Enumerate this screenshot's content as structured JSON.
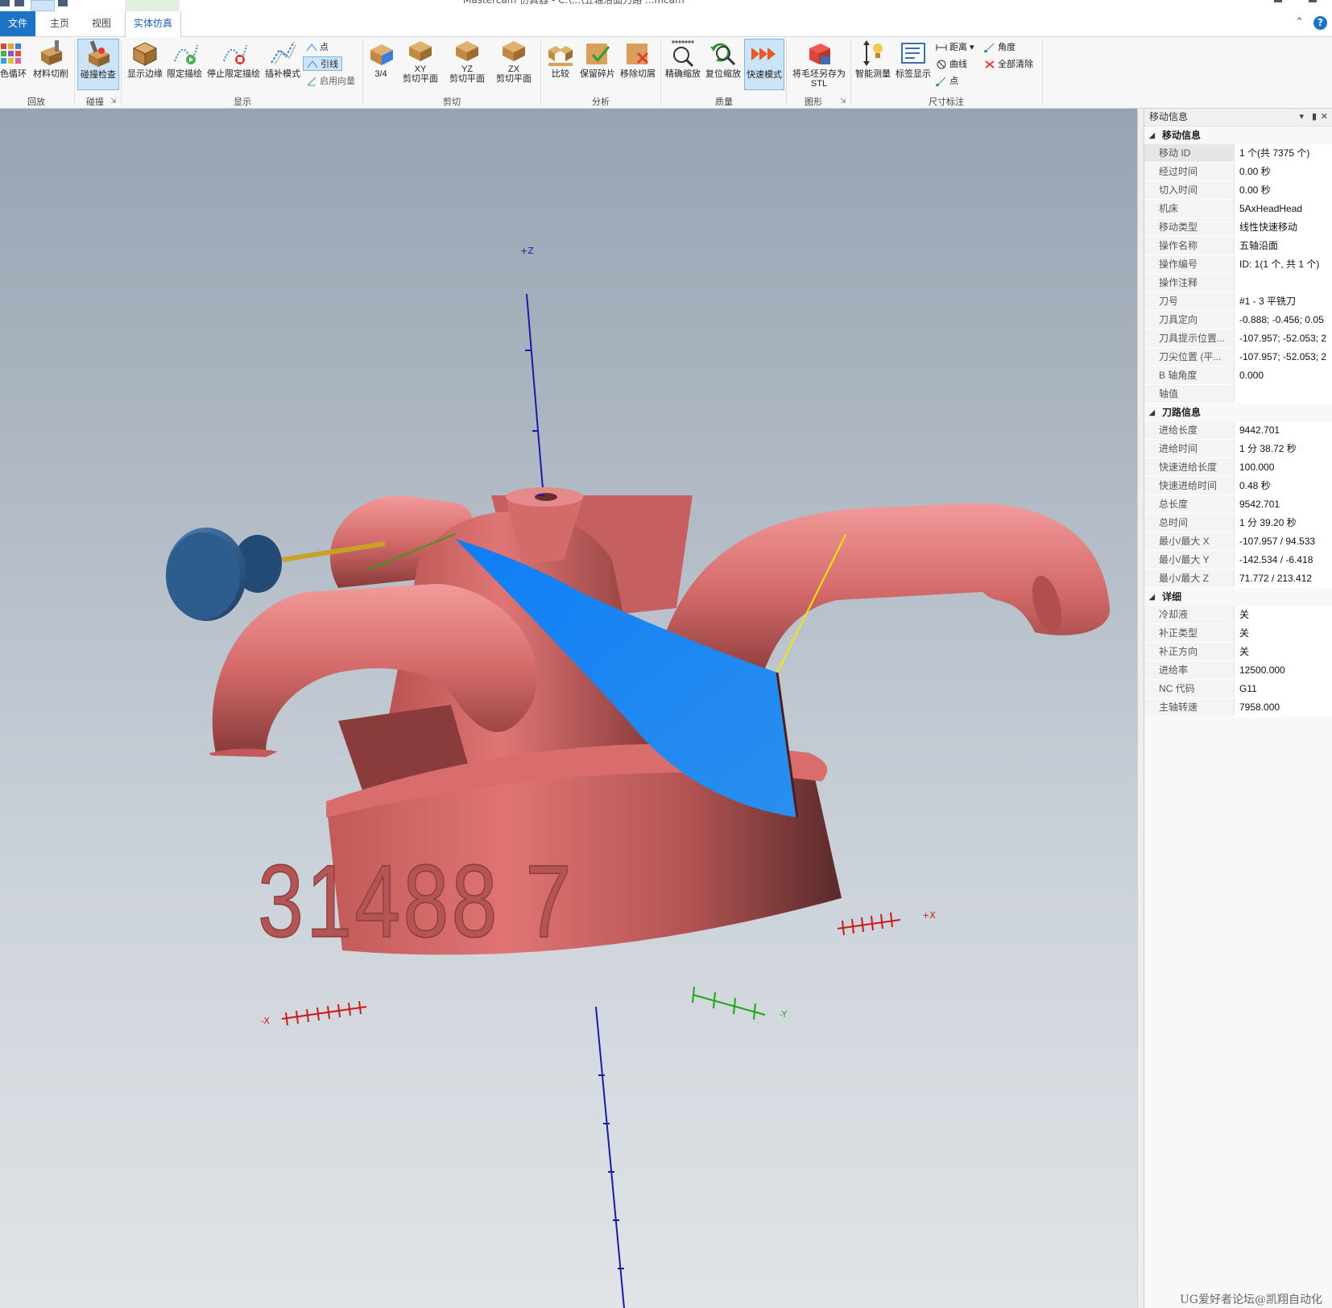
{
  "window": {
    "title": "Mastercam 仿真器 - C:\\...\\五轴沿面刀路 ...mcam"
  },
  "tabs": {
    "file": "文件",
    "home": "主页",
    "view": "视图",
    "sim": "实体仿真"
  },
  "ribbon": {
    "replay": {
      "color_cycle": "颜色循环",
      "material_cut": "材料切削",
      "group": "回放"
    },
    "collision": {
      "check": "碰撞检查",
      "group": "碰撞"
    },
    "display": {
      "show_edges": "显示边缘",
      "limit_draw": "限定描绘",
      "stop_limit": "停止限定描绘",
      "interp_mode": "插补模式",
      "point": "点",
      "lead": "引线",
      "enable_vector": "启用向量",
      "group": "显示"
    },
    "clip": {
      "three_quarter": "3/4",
      "xy1": "XY",
      "xy2": "剪切平面",
      "yz1": "YZ",
      "yz2": "剪切平面",
      "zx1": "ZX",
      "zx2": "剪切平面",
      "group": "剪切"
    },
    "analysis": {
      "compare": "比较",
      "keep_chips": "保留碎片",
      "remove_chips": "移除切屑",
      "group": "分析"
    },
    "quality": {
      "precise_zoom": "精确缩放",
      "reset_zoom": "复位缩放",
      "fast_mode": "快速模式",
      "group": "质量"
    },
    "graphics": {
      "save_stl_1": "将毛坯另存为",
      "save_stl_2": "STL",
      "group": "图形"
    },
    "dimension": {
      "smart_measure": "智能测量",
      "label_display": "标签显示",
      "distance": "距离",
      "curve": "曲线",
      "point": "点",
      "angle": "角度",
      "clear_all": "全部清除",
      "group": "尺寸标注"
    }
  },
  "viewport": {
    "axes": {
      "pz": "+Z",
      "px": "+X",
      "nx": "-X",
      "ny": "-Y"
    },
    "engraving": "31488 7",
    "colors": {
      "part": "#d66a6a",
      "toolpath": "#1f86f2",
      "holder": "#2d5c8f",
      "tool": "#c8a12b"
    }
  },
  "panel": {
    "title": "移动信息",
    "sections": [
      {
        "name": "移动信息",
        "rows": [
          {
            "k": "移动 ID",
            "v": "1 个(共 7375 个)"
          },
          {
            "k": "经过时间",
            "v": "0.00 秒"
          },
          {
            "k": "切入时间",
            "v": "0.00 秒"
          },
          {
            "k": "机床",
            "v": "5AxHeadHead"
          },
          {
            "k": "移动类型",
            "v": "线性快速移动"
          },
          {
            "k": "操作名称",
            "v": "五轴沿面"
          },
          {
            "k": "操作编号",
            "v": "ID: 1(1 个, 共 1 个)"
          },
          {
            "k": "操作注释",
            "v": ""
          },
          {
            "k": "刀号",
            "v": "#1 - 3 平铣刀"
          },
          {
            "k": "刀具定向",
            "v": "-0.888; -0.456; 0.05"
          },
          {
            "k": "刀具提示位置...",
            "v": "-107.957; -52.053; 2"
          },
          {
            "k": "刀尖位置 (平...",
            "v": "-107.957; -52.053; 2"
          },
          {
            "k": "B 轴角度",
            "v": "0.000"
          },
          {
            "k": "轴值",
            "v": ""
          }
        ]
      },
      {
        "name": "刀路信息",
        "rows": [
          {
            "k": "进给长度",
            "v": "9442.701"
          },
          {
            "k": "进给时间",
            "v": "1 分 38.72 秒"
          },
          {
            "k": "快速进给长度",
            "v": "100.000"
          },
          {
            "k": "快速进给时间",
            "v": "0.48 秒"
          },
          {
            "k": "总长度",
            "v": "9542.701"
          },
          {
            "k": "总时间",
            "v": "1 分 39.20 秒"
          },
          {
            "k": "最小/最大 X",
            "v": "-107.957 / 94.533"
          },
          {
            "k": "最小/最大 Y",
            "v": "-142.534 / -6.418"
          },
          {
            "k": "最小/最大 Z",
            "v": "71.772 / 213.412"
          }
        ]
      },
      {
        "name": "详细",
        "rows": [
          {
            "k": "冷却液",
            "v": "关"
          },
          {
            "k": "补正类型",
            "v": "关"
          },
          {
            "k": "补正方向",
            "v": "关"
          },
          {
            "k": "进给率",
            "v": "12500.000"
          },
          {
            "k": "NC 代码",
            "v": "G11"
          },
          {
            "k": "主轴转速",
            "v": "7958.000"
          }
        ]
      }
    ]
  },
  "watermark": "UG爱好者论坛@凯翔自动化"
}
